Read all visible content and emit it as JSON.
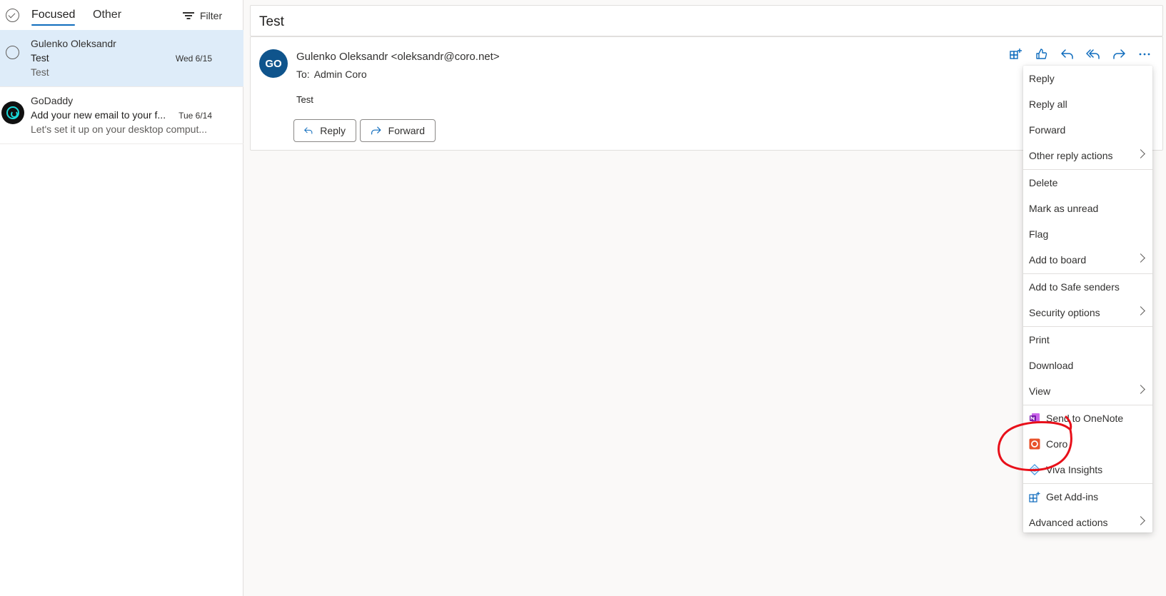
{
  "left_pane": {
    "tabs": {
      "focused": "Focused",
      "other": "Other"
    },
    "filter_label": "Filter",
    "messages": [
      {
        "sender": "Gulenko Oleksandr",
        "subject": "Test",
        "date": "Wed 6/15",
        "preview": "Test"
      },
      {
        "sender": "GoDaddy",
        "subject": "Add your new email to your f...",
        "date": "Tue 6/14",
        "preview": "Let's set it up on your desktop comput..."
      }
    ]
  },
  "reading_pane": {
    "subject": "Test",
    "avatar_initials": "GO",
    "from": "Gulenko Oleksandr <oleksandr@coro.net>",
    "to_label": "To:",
    "to_value": "Admin Coro",
    "body": "Test",
    "reply_label": "Reply",
    "forward_label": "Forward",
    "action_icons": [
      "add-in-grid-icon",
      "like-icon",
      "reply-icon",
      "reply-all-icon",
      "forward-icon",
      "more-icon"
    ]
  },
  "context_menu": {
    "items": [
      {
        "label": "Reply"
      },
      {
        "label": "Reply all"
      },
      {
        "label": "Forward"
      },
      {
        "label": "Other reply actions"
      },
      {
        "label": "Delete"
      },
      {
        "label": "Mark as unread"
      },
      {
        "label": "Flag"
      },
      {
        "label": "Add to board"
      },
      {
        "label": "Add to Safe senders"
      },
      {
        "label": "Security options"
      },
      {
        "label": "Print"
      },
      {
        "label": "Download"
      },
      {
        "label": "View"
      },
      {
        "label": "Send to OneNote"
      },
      {
        "label": "Coro"
      },
      {
        "label": "Viva Insights"
      },
      {
        "label": "Get Add-ins"
      },
      {
        "label": "Advanced actions"
      }
    ]
  },
  "colors": {
    "accent": "#0f6cbd",
    "selected_row": "#deecf9",
    "avatar_bg": "#0f548c",
    "annotation_red": "#e8101a",
    "onenote_purple": "#7719aa",
    "coro_orange": "#e8522b"
  }
}
